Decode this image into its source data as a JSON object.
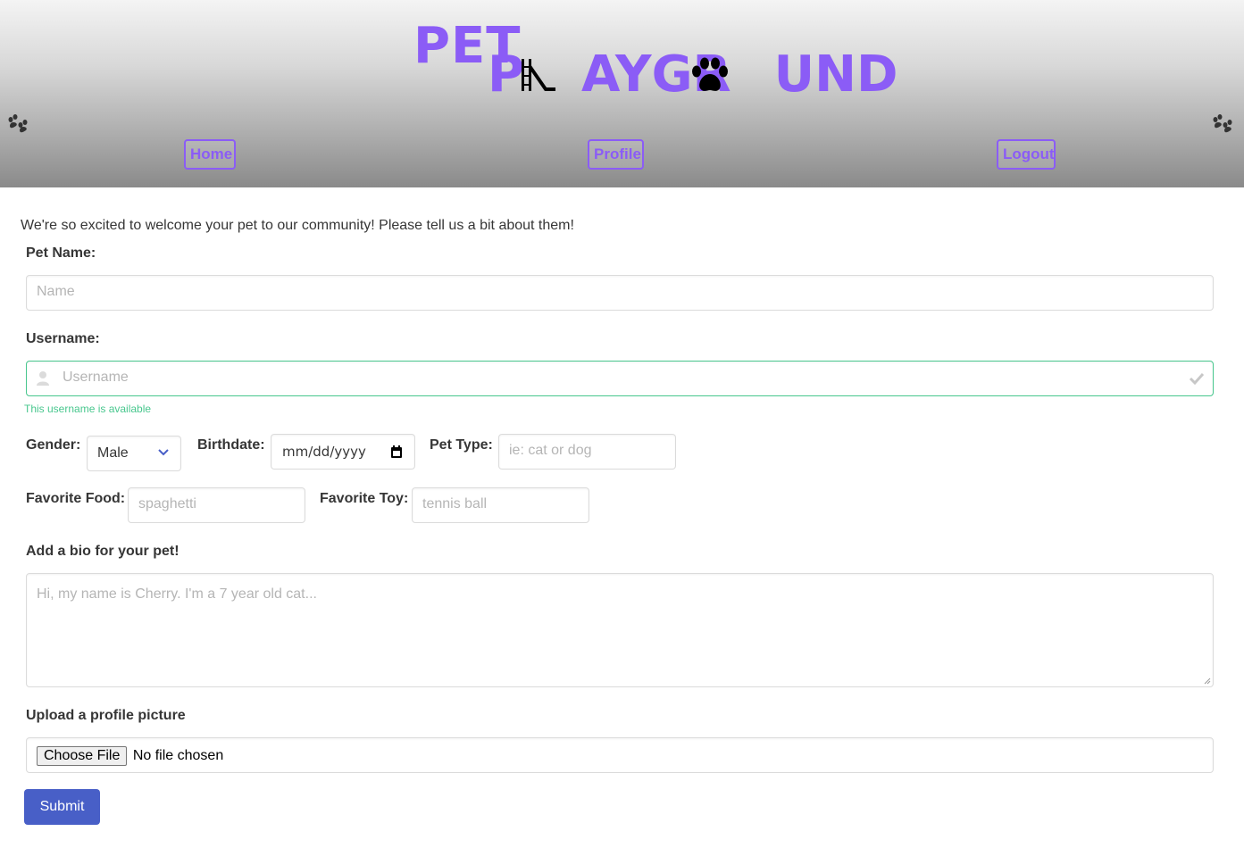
{
  "brand": {
    "pet": "PET",
    "playground": "PLAYGROUND",
    "play_p": "P",
    "play_ay": "AYGR",
    "play_und": "UND"
  },
  "nav": {
    "home": "Home",
    "profile": "Profile",
    "logout": "Logout"
  },
  "intro": "We're so excited to welcome your pet to our community! Please tell us a bit about them!",
  "form": {
    "pet_name_label": "Pet Name:",
    "pet_name_placeholder": "Name",
    "username_label": "Username:",
    "username_placeholder": "Username",
    "username_help": "This username is available",
    "gender_label": "Gender:",
    "gender_value": "Male",
    "birthdate_label": "Birthdate:",
    "birthdate_value": "mm/dd/yyyy",
    "pet_type_label": "Pet Type:",
    "pet_type_placeholder": "ie: cat or dog",
    "food_label": "Favorite Food:",
    "food_placeholder": "spaghetti",
    "toy_label": "Favorite Toy:",
    "toy_placeholder": "tennis ball",
    "bio_label": "Add a bio for your pet!",
    "bio_placeholder": "Hi, my name is Cherry. I'm a 7 year old cat...",
    "upload_label": "Upload a profile picture",
    "choose_file": "Choose File",
    "no_file": "No file chosen",
    "submit": "Submit"
  },
  "colors": {
    "brand": "#8b5cf6",
    "success": "#48c78e",
    "primary": "#485fc7"
  },
  "icons": [
    "paw-icon",
    "slide-icon",
    "user-icon",
    "check-icon",
    "chevron-down-icon",
    "calendar-icon"
  ]
}
